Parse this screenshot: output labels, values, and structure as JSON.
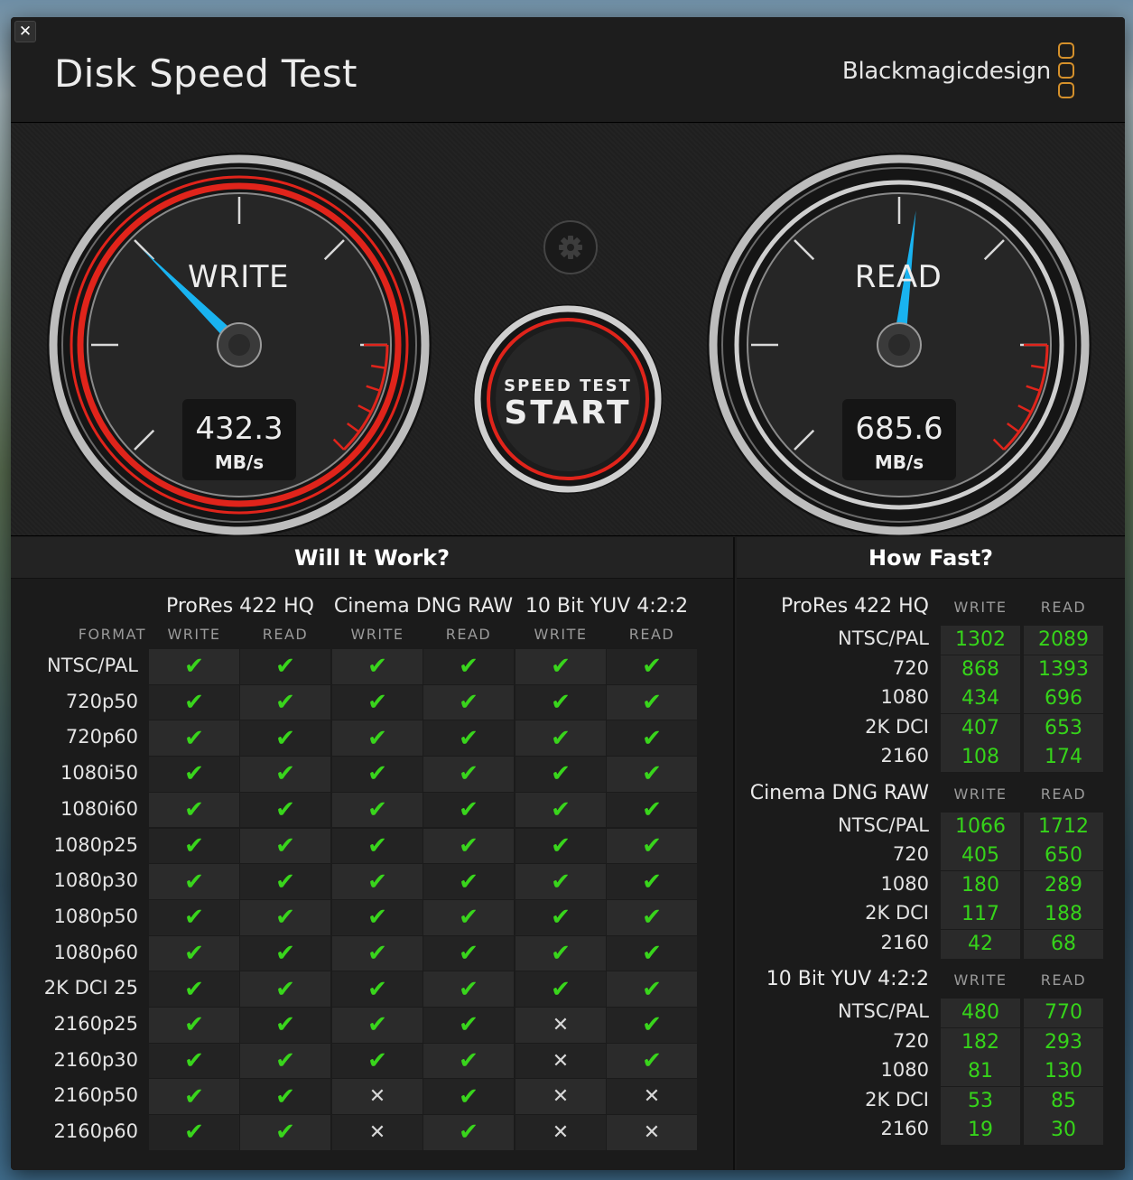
{
  "window": {
    "title": "Disk Speed Test",
    "brand": "Blackmagicdesign",
    "close_icon": "✕"
  },
  "gauges": {
    "write": {
      "label": "WRITE",
      "value": "432.3",
      "unit": "MB/s",
      "reading": 432.3
    },
    "read": {
      "label": "READ",
      "value": "685.6",
      "unit": "MB/s",
      "reading": 685.6
    },
    "start": {
      "top": "SPEED TEST",
      "main": "START"
    },
    "accent": "#e0241b",
    "needle": "#19b3f0"
  },
  "will_it_work": {
    "title": "Will It Work?",
    "format_label": "FORMAT",
    "groups": [
      {
        "name": "ProRes 422 HQ",
        "cols": [
          "WRITE",
          "READ"
        ]
      },
      {
        "name": "Cinema DNG RAW",
        "cols": [
          "WRITE",
          "READ"
        ]
      },
      {
        "name": "10 Bit YUV 4:2:2",
        "cols": [
          "WRITE",
          "READ"
        ]
      }
    ],
    "ok_symbol": "✔",
    "no_symbol": "✕",
    "rows": [
      {
        "format": "NTSC/PAL",
        "v": [
          1,
          1,
          1,
          1,
          1,
          1
        ]
      },
      {
        "format": "720p50",
        "v": [
          1,
          1,
          1,
          1,
          1,
          1
        ]
      },
      {
        "format": "720p60",
        "v": [
          1,
          1,
          1,
          1,
          1,
          1
        ]
      },
      {
        "format": "1080i50",
        "v": [
          1,
          1,
          1,
          1,
          1,
          1
        ]
      },
      {
        "format": "1080i60",
        "v": [
          1,
          1,
          1,
          1,
          1,
          1
        ]
      },
      {
        "format": "1080p25",
        "v": [
          1,
          1,
          1,
          1,
          1,
          1
        ]
      },
      {
        "format": "1080p30",
        "v": [
          1,
          1,
          1,
          1,
          1,
          1
        ]
      },
      {
        "format": "1080p50",
        "v": [
          1,
          1,
          1,
          1,
          1,
          1
        ]
      },
      {
        "format": "1080p60",
        "v": [
          1,
          1,
          1,
          1,
          1,
          1
        ]
      },
      {
        "format": "2K DCI 25",
        "v": [
          1,
          1,
          1,
          1,
          1,
          1
        ]
      },
      {
        "format": "2160p25",
        "v": [
          1,
          1,
          1,
          1,
          0,
          1
        ]
      },
      {
        "format": "2160p30",
        "v": [
          1,
          1,
          1,
          1,
          0,
          1
        ]
      },
      {
        "format": "2160p50",
        "v": [
          1,
          1,
          0,
          1,
          0,
          0
        ]
      },
      {
        "format": "2160p60",
        "v": [
          1,
          1,
          0,
          1,
          0,
          0
        ]
      }
    ]
  },
  "how_fast": {
    "title": "How Fast?",
    "cols": [
      "WRITE",
      "READ"
    ],
    "groups": [
      {
        "name": "ProRes 422 HQ",
        "rows": [
          {
            "label": "NTSC/PAL",
            "write": "1302",
            "read": "2089"
          },
          {
            "label": "720",
            "write": "868",
            "read": "1393"
          },
          {
            "label": "1080",
            "write": "434",
            "read": "696"
          },
          {
            "label": "2K DCI",
            "write": "407",
            "read": "653"
          },
          {
            "label": "2160",
            "write": "108",
            "read": "174"
          }
        ]
      },
      {
        "name": "Cinema DNG RAW",
        "rows": [
          {
            "label": "NTSC/PAL",
            "write": "1066",
            "read": "1712"
          },
          {
            "label": "720",
            "write": "405",
            "read": "650"
          },
          {
            "label": "1080",
            "write": "180",
            "read": "289"
          },
          {
            "label": "2K DCI",
            "write": "117",
            "read": "188"
          },
          {
            "label": "2160",
            "write": "42",
            "read": "68"
          }
        ]
      },
      {
        "name": "10 Bit YUV 4:2:2",
        "rows": [
          {
            "label": "NTSC/PAL",
            "write": "480",
            "read": "770"
          },
          {
            "label": "720",
            "write": "182",
            "read": "293"
          },
          {
            "label": "1080",
            "write": "81",
            "read": "130"
          },
          {
            "label": "2K DCI",
            "write": "53",
            "read": "85"
          },
          {
            "label": "2160",
            "write": "19",
            "read": "30"
          }
        ]
      }
    ]
  }
}
